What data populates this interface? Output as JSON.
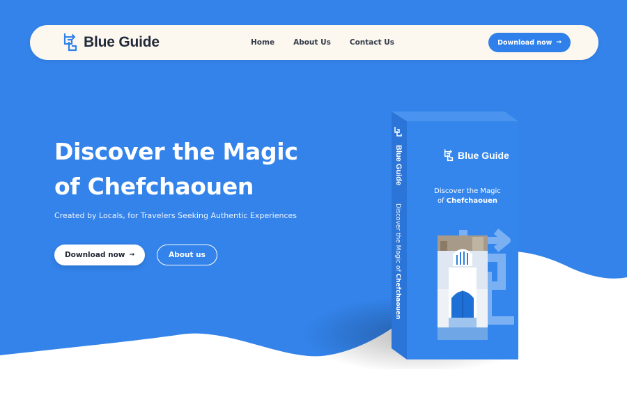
{
  "brand": {
    "name": "Blue Guide"
  },
  "nav": {
    "links": [
      "Home",
      "About Us",
      "Contact Us"
    ],
    "cta_label": "Download now"
  },
  "hero": {
    "title_line1": "Discover the Magic",
    "title_line2": "of Chefchaouen",
    "subtitle": "Created by Locals, for Travelers Seeking Authentic Experiences",
    "primary_button": "Download now",
    "secondary_button": "About us"
  },
  "book": {
    "spine_brand": "Blue Guide",
    "spine_tagline_prefix": "Discover the Magic of ",
    "spine_tagline_bold": "Chefchaouen",
    "cover_brand": "Blue Guide",
    "cover_title_line1": "Discover the Magic",
    "cover_title_prefix": "of ",
    "cover_title_bold": "Chefchaouen"
  },
  "colors": {
    "background_blue": "#3383ea",
    "nav_background": "#fdf8ef",
    "button_blue": "#2f80eb",
    "text_dark": "#222a3a"
  },
  "icons": {
    "logo": "bg-monogram-icon",
    "arrow": "arrow-right-icon"
  }
}
